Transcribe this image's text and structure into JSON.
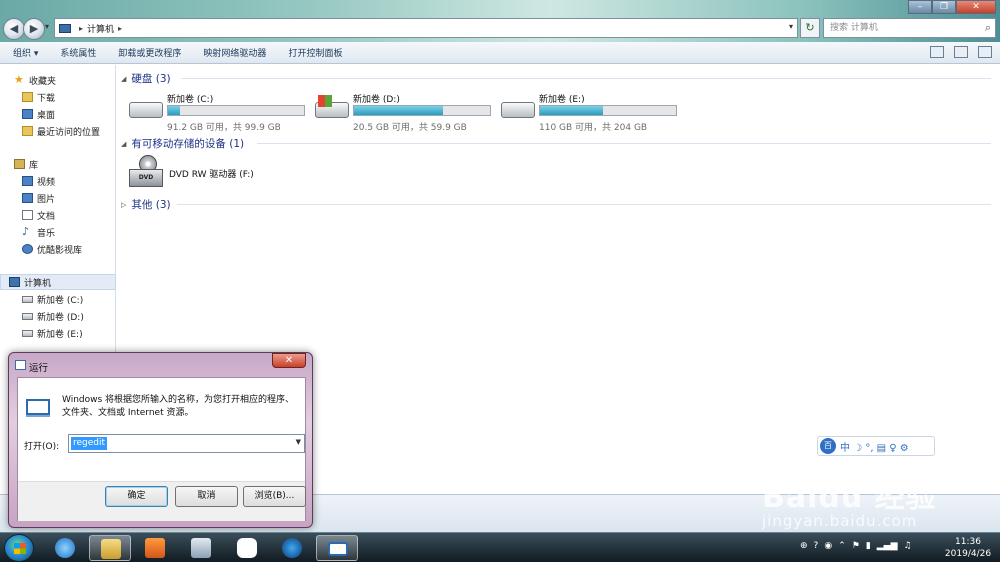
{
  "explorer": {
    "address": {
      "location": "计算机",
      "separator": "▸"
    },
    "search": {
      "placeholder": "搜索 计算机"
    },
    "toolbar": {
      "organize": "组织 ▾",
      "system_properties": "系统属性",
      "uninstall": "卸载或更改程序",
      "map_drive": "映射网络驱动器",
      "control_panel": "打开控制面板"
    },
    "nav": {
      "favorites": "收藏夹",
      "downloads": "下载",
      "desktop": "桌面",
      "recent": "最近访问的位置",
      "libraries": "库",
      "videos": "视频",
      "pictures": "图片",
      "documents": "文档",
      "music": "音乐",
      "youku": "优酷影视库",
      "computer": "计算机",
      "drive_c": "新加卷 (C:)",
      "drive_d": "新加卷 (D:)",
      "drive_e": "新加卷 (E:)"
    },
    "groups": {
      "hdd": "硬盘 (3)",
      "removable": "有可移动存储的设备 (1)",
      "other": "其他 (3)"
    },
    "drives": [
      {
        "name": "新加卷 (C:)",
        "free": "91.2 GB 可用，共 99.9 GB",
        "used_fraction": 0.087
      },
      {
        "name": "新加卷 (D:)",
        "free": "20.5 GB 可用，共 59.9 GB",
        "used_fraction": 0.658
      },
      {
        "name": "新加卷 (E:)",
        "free": "110 GB 可用，共 204 GB",
        "used_fraction": 0.461
      }
    ],
    "dvd": {
      "name": "DVD RW 驱动器 (F:)",
      "badge": "DVD"
    }
  },
  "run_dialog": {
    "title": "运行",
    "description": "Windows 将根据您所输入的名称，为您打开相应的程序、文件夹、文档或 Internet 资源。",
    "open_label": "打开(O):",
    "input_value": "regedit",
    "ok": "确定",
    "cancel": "取消",
    "browse": "浏览(B)..."
  },
  "ime": {
    "logo": "百",
    "chars": "中 ☽ °, ▤ ♀ ⚙"
  },
  "watermark": {
    "brand": "Baidu 经验",
    "site": "jingyan.baidu.com"
  },
  "taskbar": {
    "time": "11:36",
    "date": "2019/4/26"
  },
  "colors": {
    "accent": "#1e3287",
    "drive_fill": "#2a9dc0",
    "selection": "#3399ff"
  }
}
